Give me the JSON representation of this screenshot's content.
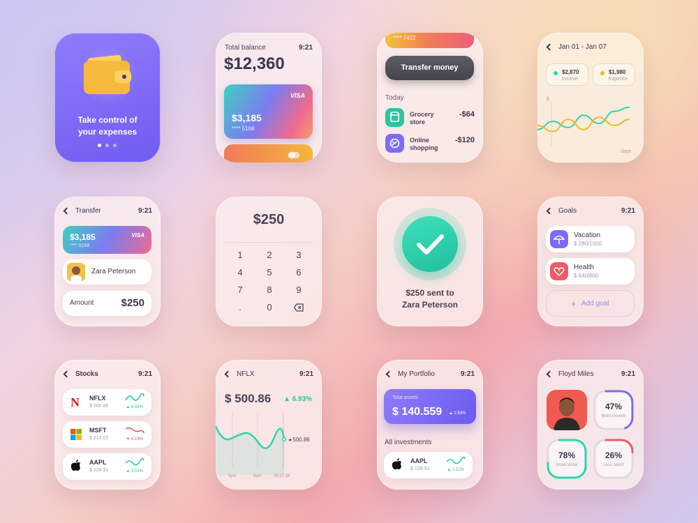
{
  "onboarding": {
    "line1": "Take control of",
    "line2": "your expenses"
  },
  "balance": {
    "title": "Total balance",
    "time": "9:21",
    "amount": "$12,360",
    "card_brand": "VISA",
    "card_amount": "$3,185",
    "card_number": "**** 5168"
  },
  "transfer_today": {
    "card_number": "**** 7422",
    "button": "Transfer money",
    "section": "Today",
    "items": [
      {
        "name1": "Grocery",
        "name2": "store",
        "amount": "-$64"
      },
      {
        "name1": "Online",
        "name2": "shopping",
        "amount": "-$120"
      }
    ]
  },
  "chart_card": {
    "range": "Jan 01 - Jan 07",
    "income_value": "$2,870",
    "income_label": "Income",
    "expense_value": "$1,980",
    "expense_label": "Expence",
    "y_label": "$",
    "x_label": "days"
  },
  "chart_data": {
    "type": "line",
    "x": [
      1,
      2,
      3,
      4,
      5,
      6,
      7
    ],
    "series": [
      {
        "name": "Income",
        "color": "#2dd4b0",
        "values": [
          35,
          55,
          40,
          70,
          50,
          80,
          90
        ]
      },
      {
        "name": "Expence",
        "color": "#f5b62a",
        "values": [
          45,
          30,
          60,
          35,
          65,
          45,
          60
        ]
      }
    ]
  },
  "transfer": {
    "title": "Transfer",
    "time": "9:21",
    "card_amount": "$3,185",
    "card_brand": "VISA",
    "card_number": "**** 5168",
    "contact": "Zara Peterson",
    "amount_label": "Amount",
    "amount": "$250"
  },
  "keypad": {
    "amount": "$250",
    "keys": [
      "1",
      "2",
      "3",
      "4",
      "5",
      "6",
      "7",
      "8",
      "9",
      ".",
      "0"
    ]
  },
  "success": {
    "line1": "$250 sent to",
    "line2": "Zara Peterson"
  },
  "goals": {
    "title": "Goals",
    "time": "9:21",
    "items": [
      {
        "name": "Vacation",
        "progress": "$ 280/1000"
      },
      {
        "name": "Health",
        "progress": "$ 640/800"
      }
    ],
    "add": "Add goal"
  },
  "stocks": {
    "title": "Stocks",
    "time": "9:21",
    "items": [
      {
        "ticker": "NFLX",
        "price": "$ 500.86",
        "change": "6.93%",
        "dir": "up"
      },
      {
        "ticker": "MSFT",
        "price": "$ 213.02",
        "change": "4.19%",
        "dir": "down"
      },
      {
        "ticker": "AAPL",
        "price": "$ 128.91",
        "change": "1.51%",
        "dir": "up"
      }
    ]
  },
  "nflx": {
    "title": "NFLX",
    "time": "9:21",
    "price": "$ 500.86",
    "change": "6.93%",
    "marker": "500.86",
    "x_labels": [
      "5pm",
      "6pm",
      "06:37:26"
    ]
  },
  "portfolio": {
    "title": "My Portfolio",
    "time": "9:21",
    "assets_label": "Total assets",
    "assets_value": "$ 140.559",
    "assets_change": "2.53%",
    "section": "All investments",
    "item": {
      "ticker": "AAPL",
      "price": "$ 128.91",
      "change": "1.51%"
    }
  },
  "profile": {
    "title": "Floyd Miles",
    "time": "9:21",
    "stats": [
      {
        "value": "47%",
        "label": "More income",
        "fraction": 0.47,
        "color": "#7b6cf6"
      },
      {
        "value": "78%",
        "label": "Goals done",
        "fraction": 0.78,
        "color": "#2dd4b0"
      },
      {
        "value": "26%",
        "label": "Less spent",
        "fraction": 0.26,
        "color": "#f05a64"
      }
    ]
  },
  "colors": {
    "accent": "#7b6cf6",
    "teal": "#2dd4b0",
    "red": "#ef5466",
    "yellow": "#f5b62a"
  }
}
